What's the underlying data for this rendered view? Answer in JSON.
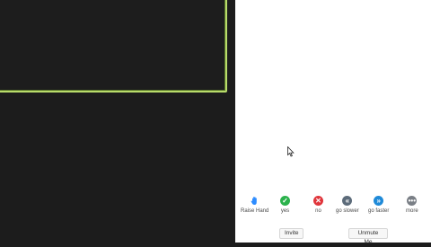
{
  "feedback": {
    "raise_hand": "Raise Hand",
    "yes": "yes",
    "no": "no",
    "go_slower": "go slower",
    "go_faster": "go faster",
    "more": "more"
  },
  "buttons": {
    "invite": "Invite",
    "unmute": "Unmute Me"
  },
  "colors": {
    "speaker_border": "#b8dc6a",
    "yes": "#2bb24c",
    "no": "#e0353b",
    "slower": "#5c6b7a",
    "faster": "#1f8ad8",
    "more": "#7a7f86",
    "hand": "#2d8cff"
  }
}
